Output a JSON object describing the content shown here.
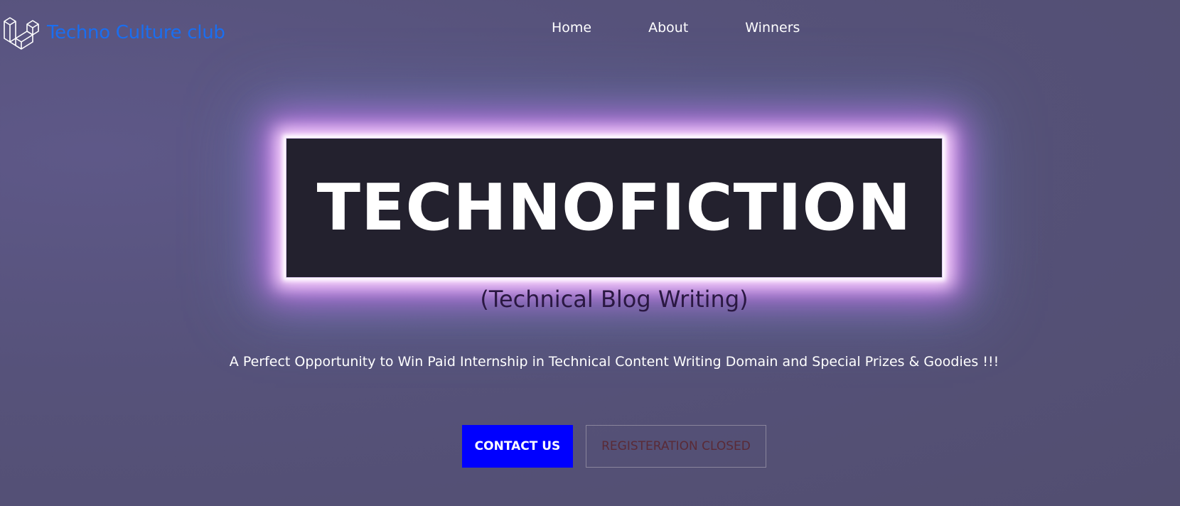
{
  "header": {
    "brand_name": "Techno Culture club",
    "logo_icon": "laravel-cubes-icon",
    "nav": [
      {
        "label": "Home"
      },
      {
        "label": "About"
      },
      {
        "label": "Winners"
      }
    ]
  },
  "hero": {
    "title": "TECHNOFICTION",
    "subtitle": "(Technical Blog Writing)",
    "tagline": "A Perfect Opportunity to Win Paid Internship in Technical Content Writing Domain and Special Prizes & Goodies !!!"
  },
  "actions": {
    "contact_label": "CONTACT US",
    "register_label": "REGISTERATION CLOSED"
  },
  "colors": {
    "background": "#56527a",
    "brand_text": "#1a6ef0",
    "hero_box": "#23212e",
    "glow": "#d46ef5",
    "contact_button": "#0000ff",
    "subtitle_text": "#2a1842"
  }
}
